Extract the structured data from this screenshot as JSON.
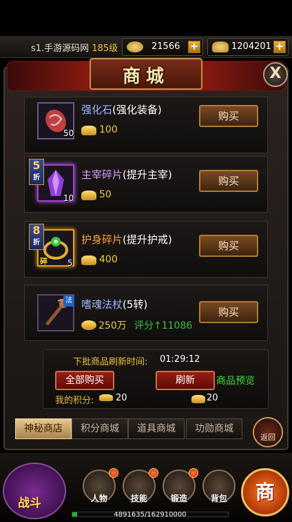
{
  "header": {
    "player_name": "s1.手游源码网",
    "player_level": "185级",
    "currency1_value": "21566",
    "currency2_value": "1204201",
    "plus_label": "+"
  },
  "panel": {
    "title": "商城",
    "close_label": "X"
  },
  "items": [
    {
      "name": "强化石",
      "desc": "(强化装备)",
      "count": "50",
      "price": "100",
      "buy_label": "购买"
    },
    {
      "name": "主宰碎片",
      "desc": "(提升主宰)",
      "count": "10",
      "price": "50",
      "buy_label": "购买",
      "discount": "5",
      "discount_unit": "折"
    },
    {
      "name": "护身碎片",
      "desc": "(提升护戒)",
      "count": "5",
      "price": "400",
      "buy_label": "购买",
      "discount": "8",
      "discount_unit": "折",
      "tag": "碎"
    },
    {
      "name": "嗜魂法杖",
      "desc": "(5转)",
      "price": "250万",
      "score_label": "评分",
      "score_value": "11086",
      "buy_label": "购买",
      "tag": "法"
    }
  ],
  "footer": {
    "refresh_label": "下批商品刷新时间:",
    "refresh_time": "01:29:12",
    "buy_all_label": "全部购买",
    "refresh_button_label": "刷新",
    "preview_label": "商品预览",
    "my_score_label": "我的积分:",
    "my_score_value": "20",
    "refresh_cost": "20"
  },
  "tabs": [
    {
      "label": "神秘商店",
      "active": true
    },
    {
      "label": "积分商城",
      "active": false
    },
    {
      "label": "道具商城",
      "active": false
    },
    {
      "label": "功勋商城",
      "active": false
    }
  ],
  "back_label": "返回",
  "bottom": {
    "battle_label": "战斗",
    "functions": [
      {
        "label": "人物",
        "icon": "character-icon"
      },
      {
        "label": "技能",
        "icon": "skill-icon"
      },
      {
        "label": "锻造",
        "icon": "forge-icon"
      },
      {
        "label": "背包",
        "icon": "bag-icon"
      }
    ],
    "shop_label": "商",
    "exp_text": "4891635/162910000",
    "exp_fraction": 0.03
  }
}
